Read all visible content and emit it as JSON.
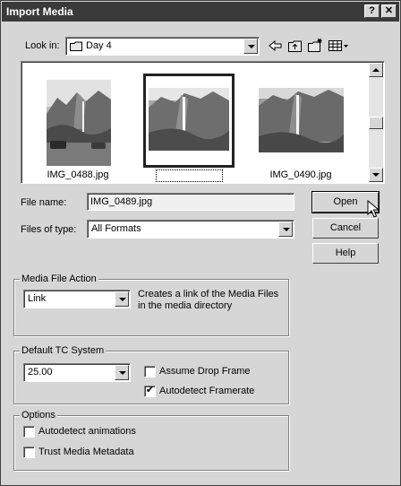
{
  "window": {
    "title": "Import Media",
    "help_glyph": "?",
    "close_glyph": "✕"
  },
  "lookin": {
    "label": "Look in:",
    "value": "Day 4"
  },
  "files": [
    {
      "name": "IMG_0488.jpg",
      "selected": false
    },
    {
      "name": "IMG_0489.jpg",
      "selected": true
    },
    {
      "name": "IMG_0490.jpg",
      "selected": false
    }
  ],
  "filename": {
    "label": "File name:",
    "value": "IMG_0489.jpg"
  },
  "filetype": {
    "label": "Files of type:",
    "value": "All Formats"
  },
  "buttons": {
    "open": "Open",
    "cancel": "Cancel",
    "help": "Help"
  },
  "media_action": {
    "title": "Media File Action",
    "value": "Link",
    "desc_line1": "Creates a link of the Media Files",
    "desc_line2": "in the media directory"
  },
  "tc": {
    "title": "Default TC System",
    "value": "25.00",
    "assume_drop": {
      "label": "Assume Drop Frame",
      "checked": false
    },
    "autodetect_fr": {
      "label": "Autodetect Framerate",
      "checked": true
    }
  },
  "options": {
    "title": "Options",
    "autodetect_anim": {
      "label": "Autodetect animations",
      "checked": false
    },
    "trust_meta": {
      "label": "Trust Media Metadata",
      "checked": false
    }
  }
}
